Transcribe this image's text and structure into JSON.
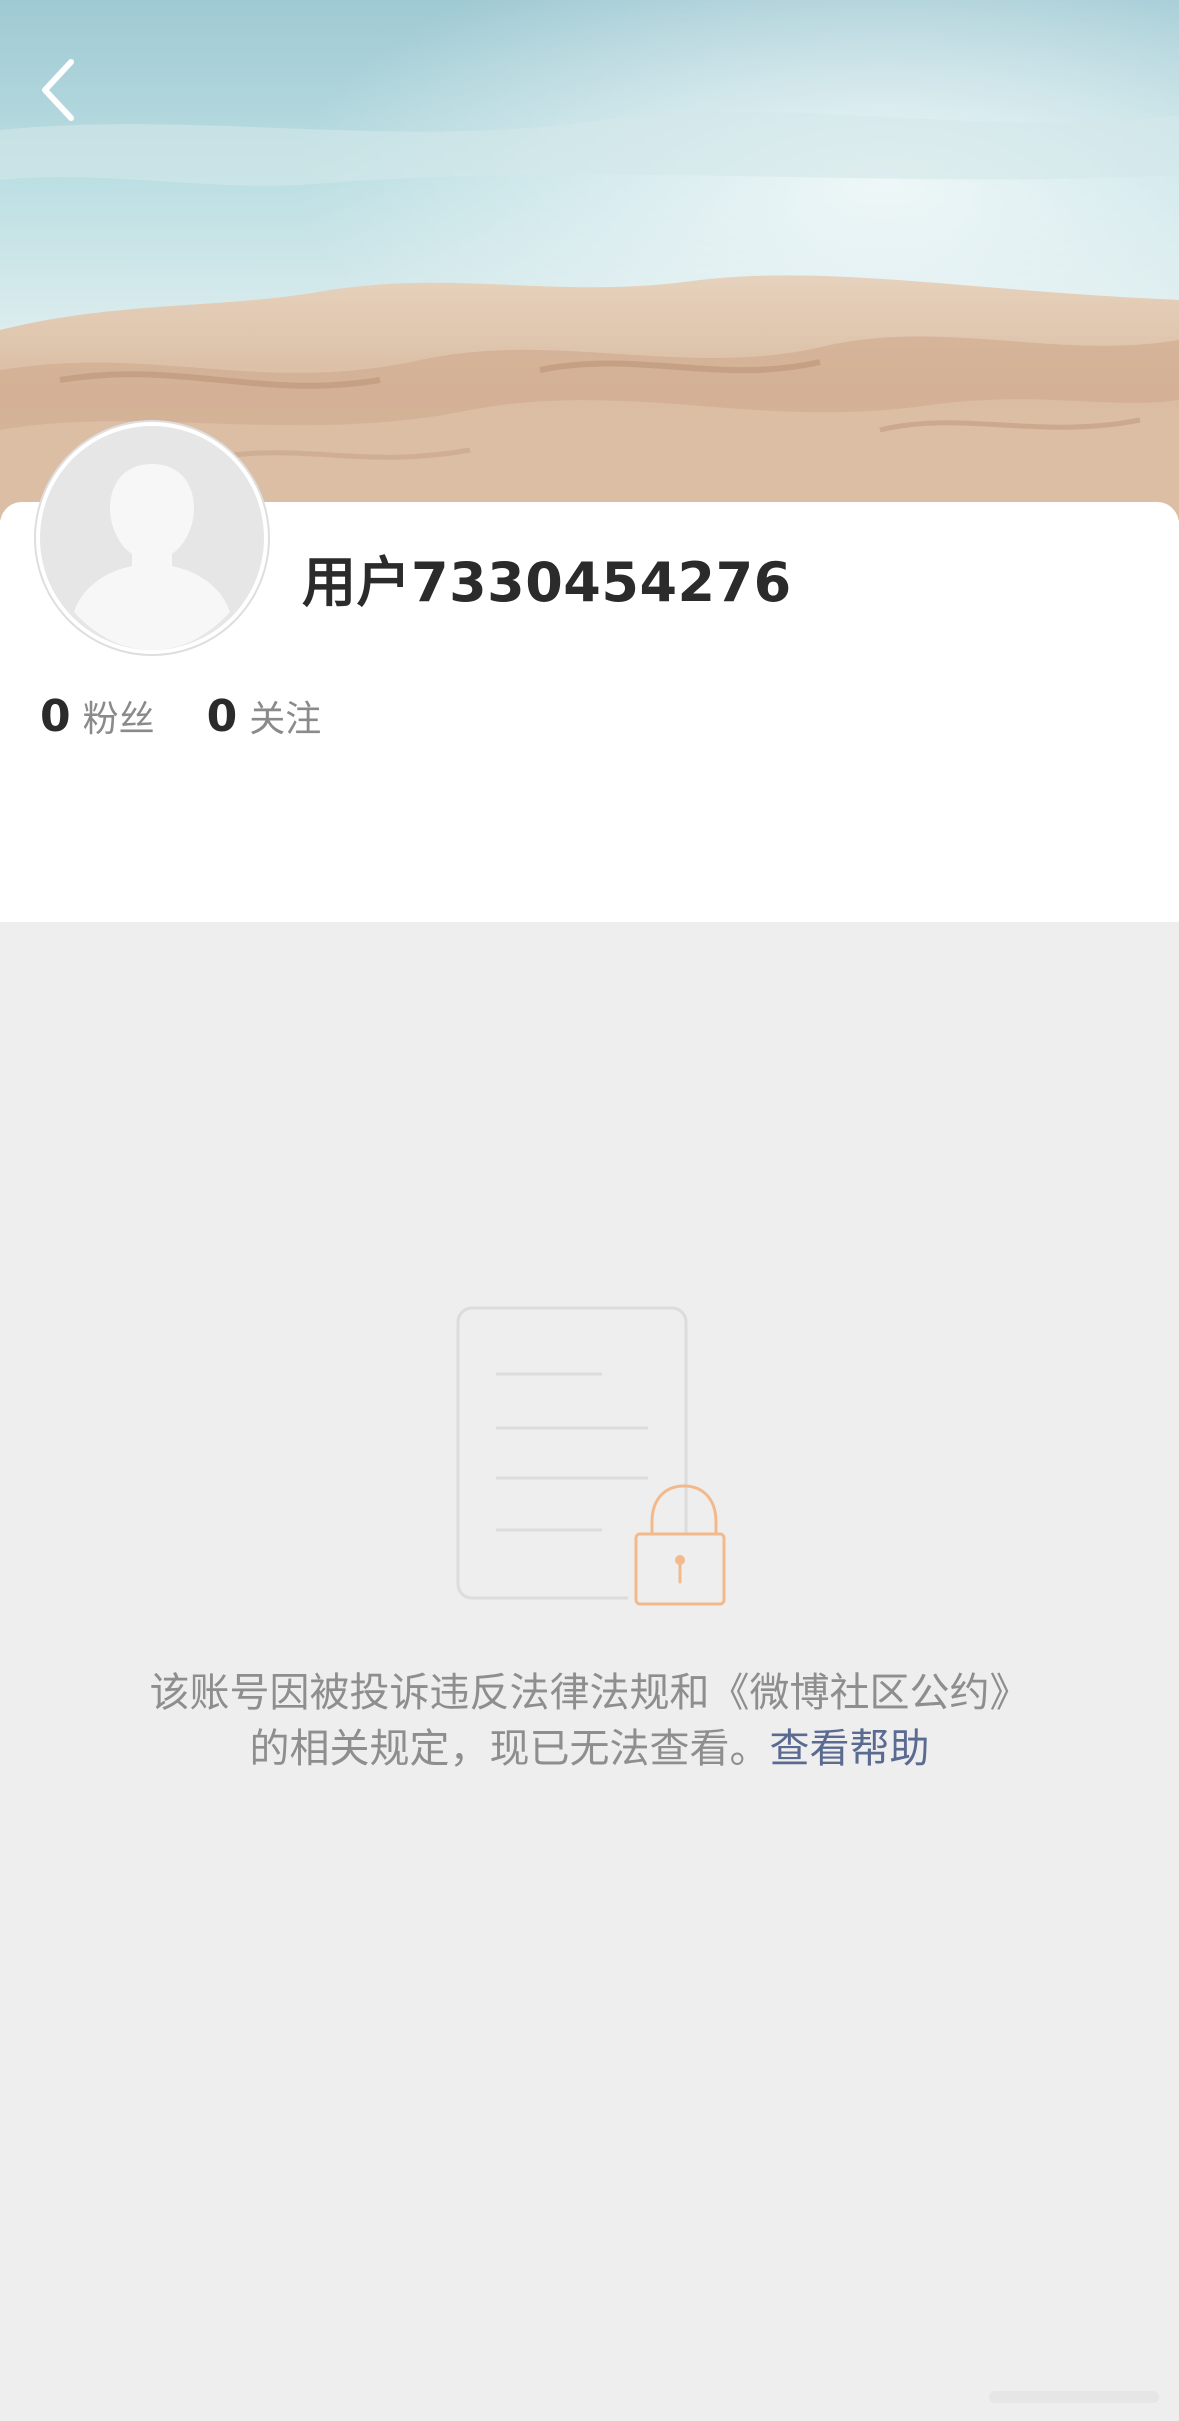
{
  "header": {
    "back_icon": "chevron-left-icon"
  },
  "profile": {
    "username": "用户7330454276",
    "avatar_icon": "default-avatar-icon",
    "stats": [
      {
        "value": "0",
        "label": "粉丝"
      },
      {
        "value": "0",
        "label": "关注"
      }
    ]
  },
  "notice": {
    "icon": "locked-document-icon",
    "line1": "该账号因被投诉违反法律法规和《微博社区公约》",
    "line2": "的相关规定，现已无法查看。",
    "help_link": "查看帮助"
  },
  "colors": {
    "background": "#eeeeee",
    "card": "#ffffff",
    "link": "#5b6a91",
    "lock_orange": "#f2ba8c"
  }
}
